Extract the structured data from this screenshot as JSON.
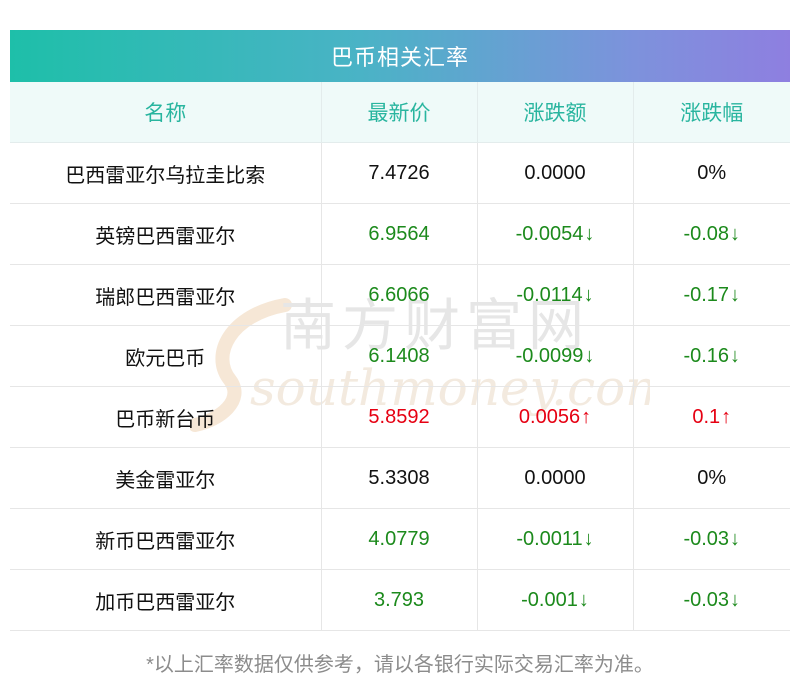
{
  "title": "巴币相关汇率",
  "columns": [
    "名称",
    "最新价",
    "涨跌额",
    "涨跌幅"
  ],
  "rows": [
    {
      "name": "巴西雷亚尔乌拉圭比索",
      "price": "7.4726",
      "change": "0.0000",
      "pct": "0%",
      "trend": "flat"
    },
    {
      "name": "英镑巴西雷亚尔",
      "price": "6.9564",
      "change": "-0.0054",
      "pct": "-0.08",
      "trend": "down"
    },
    {
      "name": "瑞郎巴西雷亚尔",
      "price": "6.6066",
      "change": "-0.0114",
      "pct": "-0.17",
      "trend": "down"
    },
    {
      "name": "欧元巴币",
      "price": "6.1408",
      "change": "-0.0099",
      "pct": "-0.16",
      "trend": "down"
    },
    {
      "name": "巴币新台币",
      "price": "5.8592",
      "change": "0.0056",
      "pct": "0.1",
      "trend": "up"
    },
    {
      "name": "美金雷亚尔",
      "price": "5.3308",
      "change": "0.0000",
      "pct": "0%",
      "trend": "flat"
    },
    {
      "name": "新币巴西雷亚尔",
      "price": "4.0779",
      "change": "-0.0011",
      "pct": "-0.03",
      "trend": "down"
    },
    {
      "name": "加币巴西雷亚尔",
      "price": "3.793",
      "change": "-0.001",
      "pct": "-0.03",
      "trend": "down"
    }
  ],
  "arrows": {
    "up": "↑",
    "down": "↓",
    "flat": ""
  },
  "colors": {
    "up": "#e60012",
    "down": "#1c8a1c",
    "flat": "#111111",
    "header_text": "#29b59f",
    "gradient_start": "#1ebfa9",
    "gradient_end": "#8e7fe0"
  },
  "watermark": {
    "chinese": "南方财富网",
    "latin": "southmoney.com"
  },
  "footnote": "*以上汇率数据仅供参考，请以各银行实际交易汇率为准。"
}
